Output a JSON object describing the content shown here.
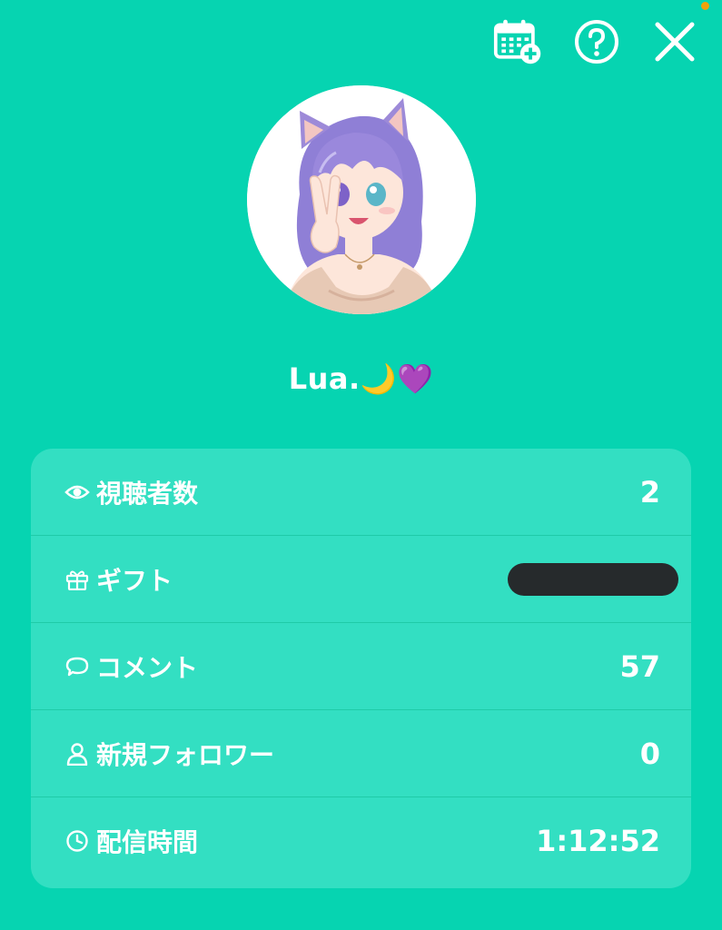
{
  "header": {
    "calendar_icon": "calendar-add-icon",
    "help_icon": "help-circle-icon",
    "close_icon": "close-icon"
  },
  "profile": {
    "name": "Lua.",
    "name_emoji_moon": "🌙",
    "name_emoji_heart": "💜"
  },
  "stats": {
    "viewers": {
      "icon": "eye-icon",
      "label": "視聴者数",
      "value": "2"
    },
    "gifts": {
      "icon": "gift-icon",
      "label": "ギフト",
      "value": ""
    },
    "comments": {
      "icon": "comment-icon",
      "label": "コメント",
      "value": "57"
    },
    "new_followers": {
      "icon": "person-icon",
      "label": "新規フォロワー",
      "value": "0"
    },
    "stream_time": {
      "icon": "clock-icon",
      "label": "配信時間",
      "value": "1:12:52"
    }
  },
  "colors": {
    "background": "#06d4b1",
    "card": "#33dfc2",
    "notification_dot": "#f2a20a",
    "redaction": "#262a2c"
  }
}
